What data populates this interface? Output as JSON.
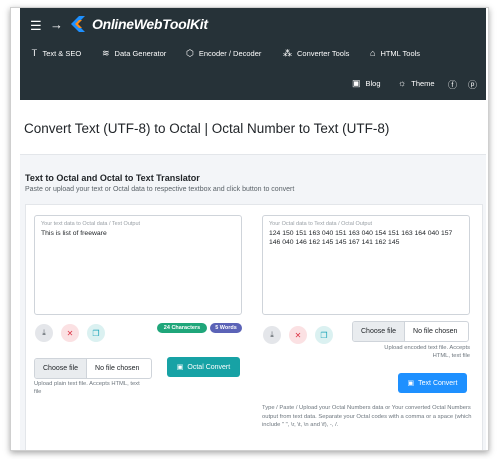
{
  "brand": {
    "name": "OnlineWebToolKit",
    "logo_colors": [
      "#1e90ff",
      "#ff8c1a"
    ]
  },
  "nav": {
    "items": [
      {
        "label": "Text & SEO",
        "icon": "text-icon"
      },
      {
        "label": "Data Generator",
        "icon": "database-icon"
      },
      {
        "label": "Encoder / Decoder",
        "icon": "cube-icon"
      },
      {
        "label": "Converter Tools",
        "icon": "converter-icon"
      },
      {
        "label": "HTML Tools",
        "icon": "html-icon"
      }
    ],
    "secondary": [
      {
        "label": "Blog",
        "icon": "blog-icon"
      },
      {
        "label": "Theme",
        "icon": "sun-icon"
      },
      {
        "label": "",
        "icon": "facebook-icon"
      },
      {
        "label": "",
        "icon": "pinterest-icon"
      }
    ]
  },
  "page": {
    "title": "Convert Text (UTF-8) to Octal | Octal Number to Text (UTF-8)"
  },
  "card": {
    "title": "Text to Octal and Octal to Text Translator",
    "subtitle": "Paste or upload your text or Octal data to respective textbox and click button to convert"
  },
  "left": {
    "placeholder": "Your text data to Octal data / Text Output",
    "value": "This is list of freeware",
    "chars_badge": "24 Characters",
    "words_badge": "5 Words",
    "file_button": "Choose file",
    "file_status": "No file chosen",
    "upload_hint": "Upload plain text file. Accepts HTML, text file",
    "convert_label": "Octal Convert"
  },
  "right": {
    "placeholder": "Your Octal data to Text data / Octal Output",
    "value": "124 150 151 163 040 151 163 040 154 151 163 164 040 157 146 040 146 162 145 145 167 141 162 145",
    "file_button": "Choose file",
    "file_status": "No file chosen",
    "upload_hint": "Upload encoded text file. Accepts HTML, text file",
    "convert_label": "Text Convert",
    "description": "Type / Paste / Upload your Octal Numbers data or Your converted Octal Numbers output from text data. Separate your Octal codes with a comma or a space (which include \" \", \\r, \\t, \\n and \\f), -, /."
  },
  "colors": {
    "nav_bg": "#263238",
    "teal": "#17a2a5",
    "blue": "#1e90ff",
    "green_badge": "#1fa67a",
    "purple_badge": "#5b63b7"
  }
}
